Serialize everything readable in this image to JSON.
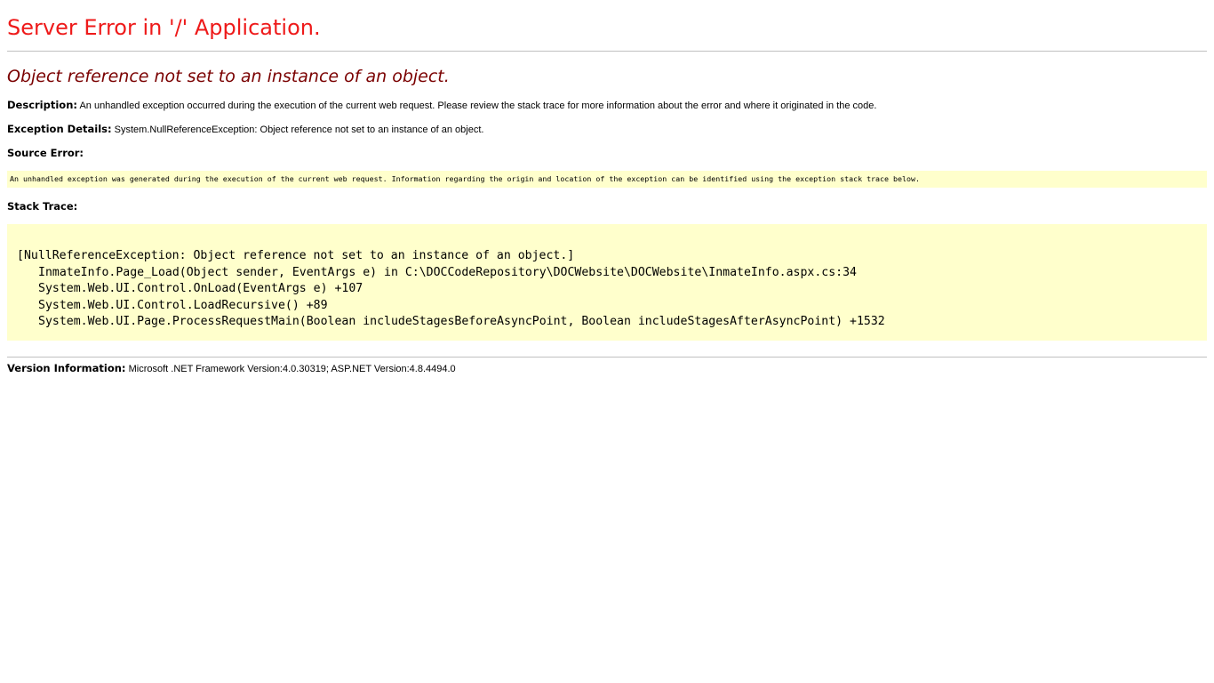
{
  "page": {
    "title": "Server Error in '/' Application.",
    "message": "Object reference not set to an instance of an object.",
    "description": {
      "label": "Description:",
      "text": "An unhandled exception occurred during the execution of the current web request. Please review the stack trace for more information about the error and where it originated in the code."
    },
    "exception_details": {
      "label": "Exception Details:",
      "text": "System.NullReferenceException: Object reference not set to an instance of an object."
    },
    "source_error": {
      "label": "Source Error:",
      "text": "An unhandled exception was generated during the execution of the current web request. Information regarding the origin and location of the exception can be identified using the exception stack trace below."
    },
    "stack_trace": {
      "label": "Stack Trace:",
      "lines": [
        "[NullReferenceException: Object reference not set to an instance of an object.]",
        "InmateInfo.Page_Load(Object sender, EventArgs e) in C:\\DOCCodeRepository\\DOCWebsite\\DOCWebsite\\InmateInfo.aspx.cs:34",
        "System.Web.UI.Control.OnLoad(EventArgs e) +107",
        "System.Web.UI.Control.LoadRecursive() +89",
        "System.Web.UI.Page.ProcessRequestMain(Boolean includeStagesBeforeAsyncPoint, Boolean includeStagesAfterAsyncPoint) +1532"
      ]
    },
    "version_information": {
      "label": "Version Information:",
      "text": "Microsoft .NET Framework Version:4.0.30319; ASP.NET Version:4.8.4494.0"
    }
  },
  "colors": {
    "title": "#ee1a1a",
    "message": "#7a0000",
    "code_background": "#ffffcc",
    "rule": "#c0c0c0"
  }
}
